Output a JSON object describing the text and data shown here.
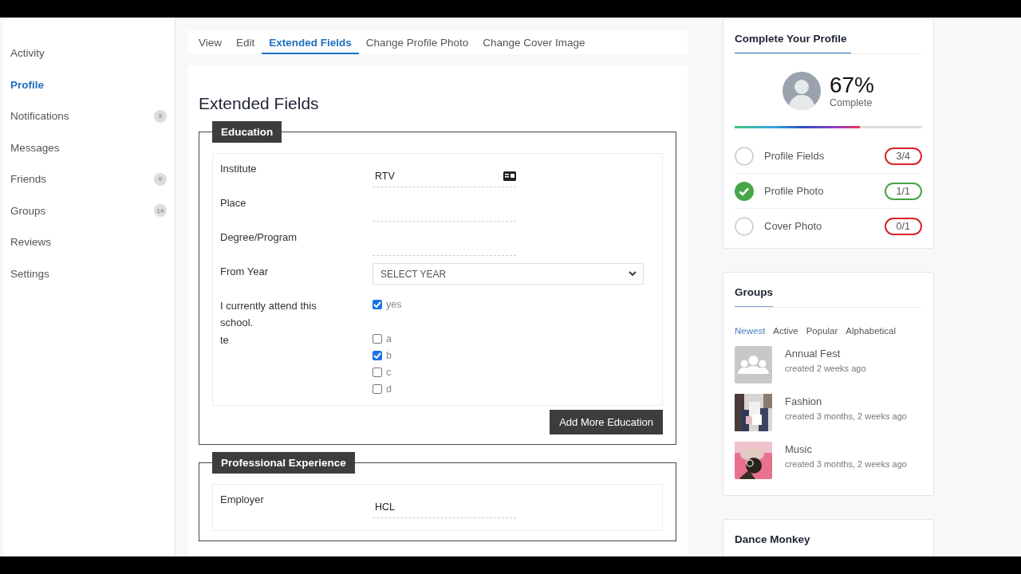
{
  "sidebar": {
    "items": [
      {
        "label": "Activity",
        "selected": false
      },
      {
        "label": "Profile",
        "selected": true
      },
      {
        "label": "Notifications",
        "selected": false,
        "count": "5"
      },
      {
        "label": "Messages",
        "selected": false
      },
      {
        "label": "Friends",
        "selected": false,
        "count": "9"
      },
      {
        "label": "Groups",
        "selected": false,
        "count": "14"
      },
      {
        "label": "Reviews",
        "selected": false
      },
      {
        "label": "Settings",
        "selected": false
      }
    ]
  },
  "tabs": [
    {
      "label": "View",
      "selected": false
    },
    {
      "label": "Edit",
      "selected": false
    },
    {
      "label": "Extended Fields",
      "selected": true
    },
    {
      "label": "Change Profile Photo",
      "selected": false
    },
    {
      "label": "Change Cover Image",
      "selected": false
    }
  ],
  "page_title": "Extended Fields",
  "sections": [
    {
      "legend": "Education",
      "button": "Add More Education",
      "fields": [
        {
          "kind": "text-icon",
          "label": "Institute",
          "value": "RTV"
        },
        {
          "kind": "text",
          "label": "Place"
        },
        {
          "kind": "text",
          "label": "Degree/Program"
        },
        {
          "kind": "select",
          "label": "From Year",
          "value": "SELECT YEAR"
        },
        {
          "kind": "checkboxes",
          "label": "I currently attend this school.",
          "options": [
            {
              "label": "yes",
              "checked": true
            }
          ]
        },
        {
          "kind": "checkboxes",
          "label": "te",
          "options": [
            {
              "label": "a",
              "checked": false
            },
            {
              "label": "b",
              "checked": true
            },
            {
              "label": "c",
              "checked": false
            },
            {
              "label": "d",
              "checked": false
            }
          ]
        }
      ]
    },
    {
      "legend": "Professional Experience",
      "fields": [
        {
          "kind": "text",
          "label": "Employer",
          "value": "HCL"
        }
      ]
    }
  ],
  "profile_completion": {
    "title": "Complete Your Profile",
    "percent": "67%",
    "caption": "Complete",
    "level": 0.67,
    "items": [
      {
        "label": "Profile Fields",
        "done": false,
        "count": "3/4"
      },
      {
        "label": "Profile Photo",
        "done": true,
        "count": "1/1"
      },
      {
        "label": "Cover Photo",
        "done": false,
        "count": "0/1"
      }
    ]
  },
  "groups_widget": {
    "title": "Groups",
    "filters": [
      {
        "label": "Newest",
        "selected": true
      },
      {
        "label": "Active",
        "selected": false
      },
      {
        "label": "Popular",
        "selected": false
      },
      {
        "label": "Alphabetical",
        "selected": false
      }
    ],
    "items": [
      {
        "name": "Annual Fest",
        "meta": "created 2 weeks ago",
        "kind": "placeholder"
      },
      {
        "name": "Fashion",
        "meta": "created 3 months, 2 weeks ago",
        "kind": "picture"
      },
      {
        "name": "Music",
        "meta": "created 3 months, 2 weeks ago",
        "kind": "picture"
      }
    ]
  },
  "next_widget": {
    "title": "Dance Monkey"
  }
}
